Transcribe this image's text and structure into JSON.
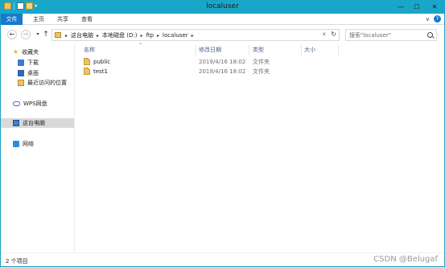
{
  "window": {
    "title": "localuser"
  },
  "ribbon": {
    "tabs": [
      "文件",
      "主页",
      "共享",
      "查看"
    ]
  },
  "address": {
    "crumbs": [
      "这台电脑",
      "本地磁盘 (D:)",
      "ftp",
      "localuser"
    ]
  },
  "search": {
    "placeholder": "搜索\"localuser\""
  },
  "sidebar": {
    "items": [
      {
        "label": "收藏夹",
        "icon": "star-icon"
      },
      {
        "label": "下载",
        "icon": "download-folder-icon"
      },
      {
        "label": "桌面",
        "icon": "desktop-icon"
      },
      {
        "label": "最近访问的位置",
        "icon": "recent-places-icon"
      },
      {
        "label": "WPS网盘",
        "icon": "cloud-icon"
      },
      {
        "label": "这台电脑",
        "icon": "computer-icon"
      },
      {
        "label": "网络",
        "icon": "network-icon"
      }
    ]
  },
  "columns": {
    "name": "名称",
    "date": "修改日期",
    "type": "类型",
    "size": "大小"
  },
  "files": [
    {
      "name": "public",
      "date": "2019/4/16 18:02",
      "type": "文件夹",
      "size": ""
    },
    {
      "name": "test1",
      "date": "2019/4/16 18:02",
      "type": "文件夹",
      "size": ""
    }
  ],
  "status": {
    "count": "2 个项目"
  },
  "watermark": "CSDN @Belugaf"
}
